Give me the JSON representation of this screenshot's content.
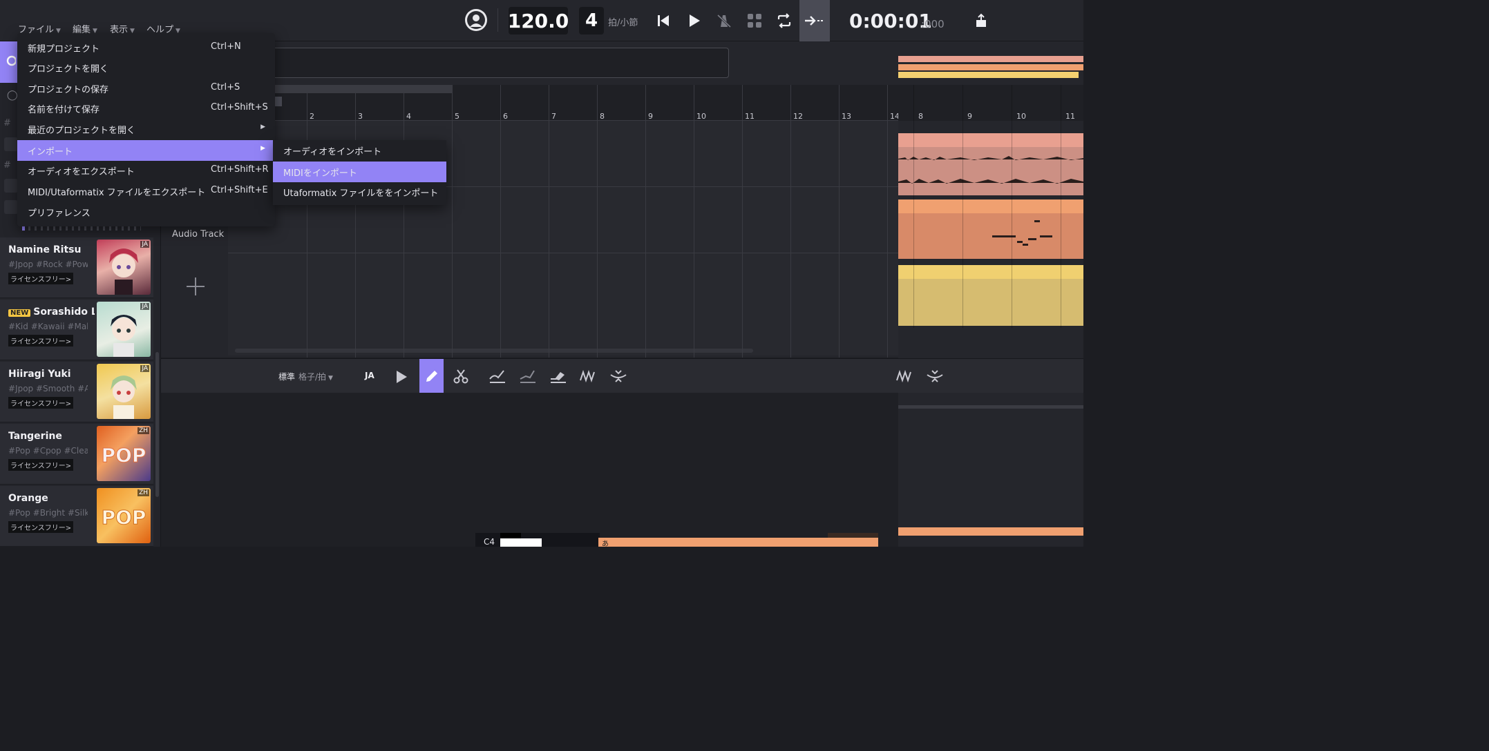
{
  "menubar": {
    "file": "ファイル",
    "edit": "編集",
    "view": "表示",
    "help": "ヘルプ"
  },
  "transport": {
    "tempo": "120.0",
    "beats": "4",
    "beats_unit": "拍/小節",
    "time_main": "0:00:01",
    "time_ms": ":000"
  },
  "file_menu": {
    "items": [
      {
        "label": "新規プロジェクト",
        "shortcut": "Ctrl+N"
      },
      {
        "label": "プロジェクトを開く",
        "shortcut": ""
      },
      {
        "label": "プロジェクトの保存",
        "shortcut": "Ctrl+S"
      },
      {
        "label": "名前を付けて保存",
        "shortcut": "Ctrl+Shift+S"
      },
      {
        "label": "最近のプロジェクトを開く",
        "shortcut": ""
      },
      {
        "label": "インポート",
        "shortcut": ""
      },
      {
        "label": "オーディオをエクスポート",
        "shortcut": "Ctrl+Shift+R"
      },
      {
        "label": "MIDI/Utaformatix ファイルをエクスポート",
        "shortcut": "Ctrl+Shift+E"
      },
      {
        "label": "プリファレンス",
        "shortcut": ""
      }
    ]
  },
  "import_submenu": {
    "items": [
      {
        "label": "オーディオをインポート"
      },
      {
        "label": "MIDIをインポート"
      },
      {
        "label": "Utaformatix ファイルををインポート"
      }
    ]
  },
  "ruler": {
    "bars": [
      "2",
      "3",
      "4",
      "5",
      "6",
      "7",
      "8",
      "9",
      "10",
      "11",
      "12",
      "13",
      "14"
    ],
    "right_bars": [
      "8",
      "9",
      "10",
      "11"
    ]
  },
  "tracks": {
    "audio_track_label": "Audio Track"
  },
  "voices": [
    {
      "name": "Namine Ritsu",
      "tags": "#Jpop #Rock #Powe",
      "license": "ライセンスフリー>",
      "lang": "JA",
      "new": ""
    },
    {
      "name": "Sorashido Le",
      "tags": "#Kid #Kawaii #Male",
      "license": "ライセンスフリー>",
      "lang": "JA",
      "new": "NEW"
    },
    {
      "name": "Hiiragi Yuki",
      "tags": "#Jpop #Smooth #AC",
      "license": "ライセンスフリー>",
      "lang": "JA",
      "new": ""
    },
    {
      "name": "Tangerine",
      "tags": "#Pop #Cpop #Clear",
      "license": "ライセンスフリー>",
      "lang": "ZH",
      "new": ""
    },
    {
      "name": "Orange",
      "tags": "#Pop #Bright #Silky",
      "license": "ライセンスフリー>",
      "lang": "ZH",
      "new": ""
    }
  ],
  "editbar": {
    "mode": "標準",
    "grid": "格子/拍",
    "lang": "JA"
  },
  "pianoroll": {
    "key_label": "C4",
    "note_lyric": "あ"
  },
  "colors": {
    "accent": "#9283f5",
    "salmon": "#e8a090",
    "orange": "#f0a070",
    "yellow": "#e8cc70"
  }
}
